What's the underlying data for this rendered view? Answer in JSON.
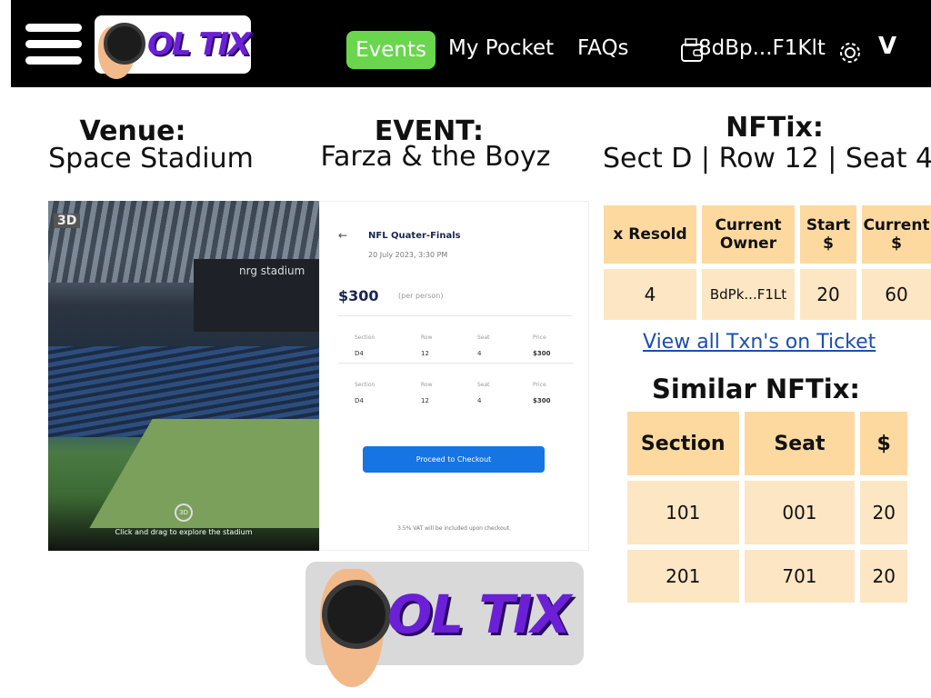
{
  "nav": {
    "brand": "OL TIX",
    "events_label": "Events",
    "pocket_label": "My Pocket",
    "faqs_label": "FAQs",
    "wallet_address": "8dBp...F1Klt",
    "menu_chevron": "V",
    "accent": "#6ad64d"
  },
  "header": {
    "venue_label": "Venue:",
    "venue_value": "Space Stadium",
    "event_label": "EVENT:",
    "event_value": "Farza & the Boyz",
    "nftix_label": "NFTix:",
    "nftix_value": "Sect D | Row 12 | Seat 4"
  },
  "stadium": {
    "badge": "3D",
    "brand_text": "nrg stadium",
    "rotate_label": "3D",
    "caption": "Click and drag to explore the stadium"
  },
  "checkout": {
    "back_arrow": "←",
    "title": "NFL Quater-Finals",
    "date": "20 July 2023, 3:30 PM",
    "price": "$300",
    "per": "(per person)",
    "headers": [
      "Section",
      "Row",
      "Seat",
      "Price"
    ],
    "rows": [
      [
        "D4",
        "12",
        "4",
        "$300"
      ],
      [
        "D4",
        "12",
        "4",
        "$300"
      ]
    ],
    "button_label": "Proceed to Checkout",
    "vat_note": "3.5% VAT will be included upon checkout."
  },
  "ticket_table": {
    "headers": [
      "x Resold",
      "Current Owner",
      "Start $",
      "Current $"
    ],
    "row": [
      "4",
      "BdPk...F1Lt",
      "20",
      "60"
    ]
  },
  "view_txns_label": "View all Txn's on Ticket",
  "similar": {
    "title": "Similar NFTix:",
    "headers": [
      "Section",
      "Seat",
      "$"
    ],
    "rows": [
      [
        "101",
        "001",
        "20"
      ],
      [
        "201",
        "701",
        "20"
      ]
    ]
  },
  "colors": {
    "header_cell": "#fdd99f",
    "body_cell": "#fde6c4",
    "link": "#1a4fb0",
    "checkout_button": "#1674e3"
  }
}
